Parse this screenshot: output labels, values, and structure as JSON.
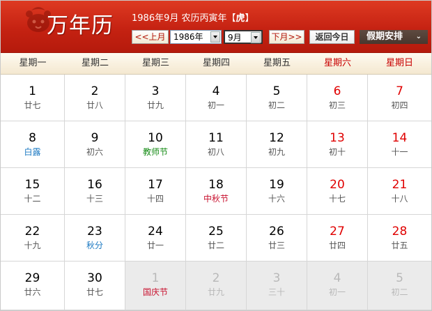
{
  "header": {
    "app_title": "万年历",
    "solar_date": "1986年9月",
    "lunar_year": "农历丙寅年",
    "zodiac_bracket_open": "【",
    "zodiac": "虎",
    "zodiac_bracket_close": "】"
  },
  "toolbar": {
    "prev_month_label": "<<上月",
    "year_select_value": "1986年",
    "month_select_value": "9月",
    "next_month_label": "下月>>",
    "today_label": "返回今日",
    "holiday_label": "假期安排",
    "holiday_chevron": "⌄"
  },
  "colors": {
    "header_red": "#c52212",
    "weekend_red": "#e00000",
    "solar_term_blue": "#1a78c2",
    "teacher_day_green": "#148a14",
    "festival_red": "#c8102e"
  },
  "weekdays": [
    "星期一",
    "星期二",
    "星期三",
    "星期四",
    "星期五",
    "星期六",
    "星期日"
  ],
  "calendar": {
    "weeks": [
      [
        {
          "day": "1",
          "lunar": "廿七",
          "type": ""
        },
        {
          "day": "2",
          "lunar": "廿八",
          "type": ""
        },
        {
          "day": "3",
          "lunar": "廿九",
          "type": ""
        },
        {
          "day": "4",
          "lunar": "初一",
          "type": ""
        },
        {
          "day": "5",
          "lunar": "初二",
          "type": ""
        },
        {
          "day": "6",
          "lunar": "初三",
          "type": ""
        },
        {
          "day": "7",
          "lunar": "初四",
          "type": ""
        }
      ],
      [
        {
          "day": "8",
          "lunar": "白露",
          "type": "term"
        },
        {
          "day": "9",
          "lunar": "初六",
          "type": ""
        },
        {
          "day": "10",
          "lunar": "教师节",
          "type": "teacher"
        },
        {
          "day": "11",
          "lunar": "初八",
          "type": ""
        },
        {
          "day": "12",
          "lunar": "初九",
          "type": ""
        },
        {
          "day": "13",
          "lunar": "初十",
          "type": ""
        },
        {
          "day": "14",
          "lunar": "十一",
          "type": ""
        }
      ],
      [
        {
          "day": "15",
          "lunar": "十二",
          "type": ""
        },
        {
          "day": "16",
          "lunar": "十三",
          "type": ""
        },
        {
          "day": "17",
          "lunar": "十四",
          "type": ""
        },
        {
          "day": "18",
          "lunar": "中秋节",
          "type": "festival"
        },
        {
          "day": "19",
          "lunar": "十六",
          "type": ""
        },
        {
          "day": "20",
          "lunar": "十七",
          "type": ""
        },
        {
          "day": "21",
          "lunar": "十八",
          "type": ""
        }
      ],
      [
        {
          "day": "22",
          "lunar": "十九",
          "type": ""
        },
        {
          "day": "23",
          "lunar": "秋分",
          "type": "term"
        },
        {
          "day": "24",
          "lunar": "廿一",
          "type": ""
        },
        {
          "day": "25",
          "lunar": "廿二",
          "type": ""
        },
        {
          "day": "26",
          "lunar": "廿三",
          "type": ""
        },
        {
          "day": "27",
          "lunar": "廿四",
          "type": ""
        },
        {
          "day": "28",
          "lunar": "廿五",
          "type": ""
        }
      ],
      [
        {
          "day": "29",
          "lunar": "廿六",
          "type": ""
        },
        {
          "day": "30",
          "lunar": "廿七",
          "type": ""
        },
        {
          "day": "1",
          "lunar": "国庆节",
          "type": "festival",
          "other_month": true
        },
        {
          "day": "2",
          "lunar": "廿九",
          "type": "",
          "other_month": true
        },
        {
          "day": "3",
          "lunar": "三十",
          "type": "",
          "other_month": true
        },
        {
          "day": "4",
          "lunar": "初一",
          "type": "",
          "other_month": true
        },
        {
          "day": "5",
          "lunar": "初二",
          "type": "",
          "other_month": true
        }
      ]
    ]
  }
}
